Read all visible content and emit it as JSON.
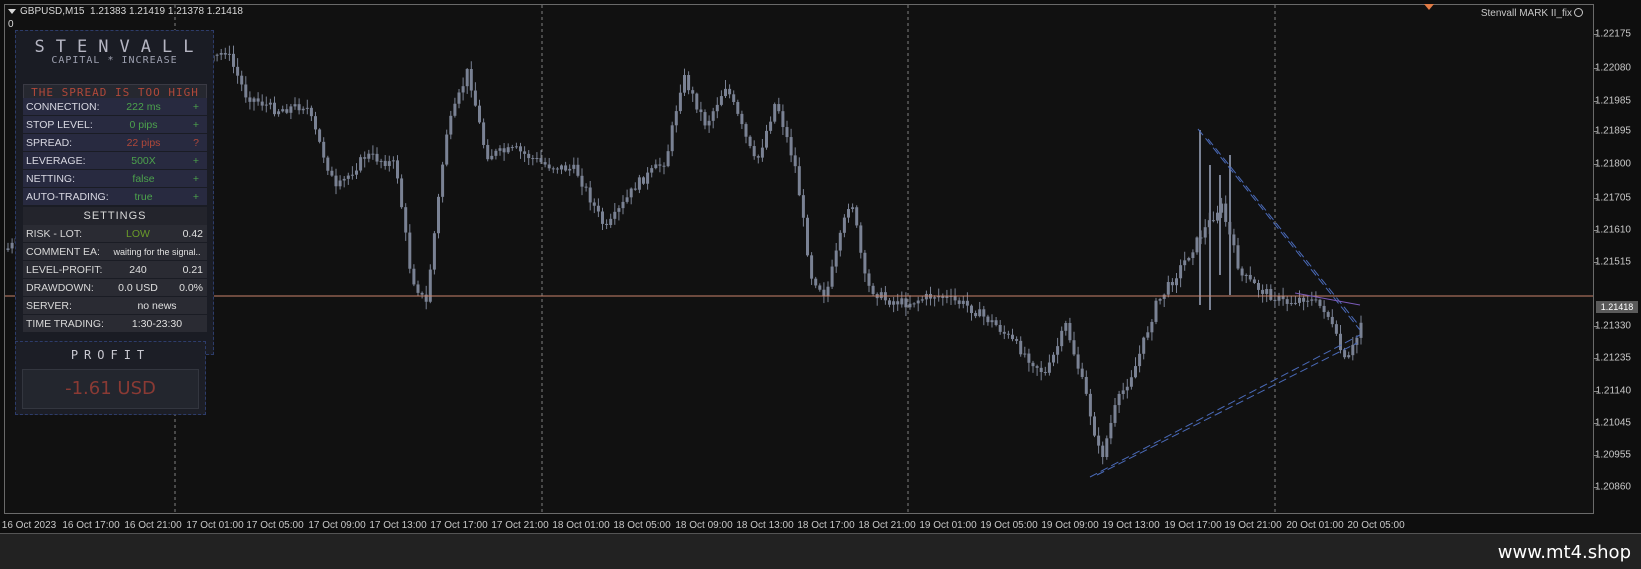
{
  "symbol": {
    "name": "GBPUSD,M15",
    "ohlc": "1.21383 1.21419 1.21378 1.21418",
    "subwindow_zero": "0"
  },
  "ea_label": "Stenvall MARK II_fix",
  "current_price": "1.21418",
  "price_axis": {
    "ticks": [
      "1.22175",
      "1.22080",
      "1.21985",
      "1.21895",
      "1.21800",
      "1.21705",
      "1.21610",
      "1.21515",
      "1.21330",
      "1.21235",
      "1.21140",
      "1.21045",
      "1.20955",
      "1.20860"
    ]
  },
  "time_axis": {
    "ticks": [
      "16 Oct 2023",
      "16 Oct 17:00",
      "16 Oct 21:00",
      "17 Oct 01:00",
      "17 Oct 05:00",
      "17 Oct 09:00",
      "17 Oct 13:00",
      "17 Oct 17:00",
      "17 Oct 21:00",
      "18 Oct 01:00",
      "18 Oct 05:00",
      "18 Oct 09:00",
      "18 Oct 13:00",
      "18 Oct 17:00",
      "18 Oct 21:00",
      "19 Oct 01:00",
      "19 Oct 05:00",
      "19 Oct 09:00",
      "19 Oct 13:00",
      "19 Oct 17:00",
      "19 Oct 21:00",
      "20 Oct 01:00",
      "20 Oct 05:00"
    ]
  },
  "panel": {
    "brand": "STENVALL",
    "subtitle": "CAPITAL * INCREASE",
    "warning": "THE SPREAD IS TOO HIGH",
    "status": [
      {
        "label": "CONNECTION:",
        "value": "222 ms",
        "status": "+",
        "color": "#4ca24c"
      },
      {
        "label": "STOP LEVEL:",
        "value": "0 pips",
        "status": "+",
        "color": "#4ca24c"
      },
      {
        "label": "SPREAD:",
        "value": "22 pips",
        "status": "?",
        "color": "#b0483a"
      },
      {
        "label": "LEVERAGE:",
        "value": "500X",
        "status": "+",
        "color": "#4ca24c"
      },
      {
        "label": "NETTING:",
        "value": "false",
        "status": "+",
        "color": "#4ca24c"
      },
      {
        "label": "AUTO-TRADING:",
        "value": "true",
        "status": "+",
        "color": "#4ca24c"
      }
    ],
    "settings_title": "SETTINGS",
    "settings": {
      "risk": {
        "label": "RISK - LOT:",
        "level": "LOW",
        "lot": "0.42",
        "level_color": "#6a9a2a"
      },
      "comment": {
        "label": "COMMENT EA:",
        "value": "waiting for the signal.."
      },
      "level_profit": {
        "label": "LEVEL-PROFIT:",
        "v1": "240",
        "v2": "0.21"
      },
      "drawdown": {
        "label": "DRAWDOWN:",
        "v1": "0.0 USD",
        "v2": "0.0%"
      },
      "server": {
        "label": "SERVER:",
        "value": "no news"
      },
      "time": {
        "label": "TIME TRADING:",
        "value": "1:30-23:30"
      }
    }
  },
  "profit": {
    "title": "PROFIT",
    "value": "-1.61 USD"
  },
  "watermark": "www.mt4.shop",
  "colors": {
    "background": "#111111",
    "candle": "#7a8294",
    "price_line": "#c9846a",
    "trend_line": "#4a6ab8",
    "grid": "#9a9a9a"
  }
}
